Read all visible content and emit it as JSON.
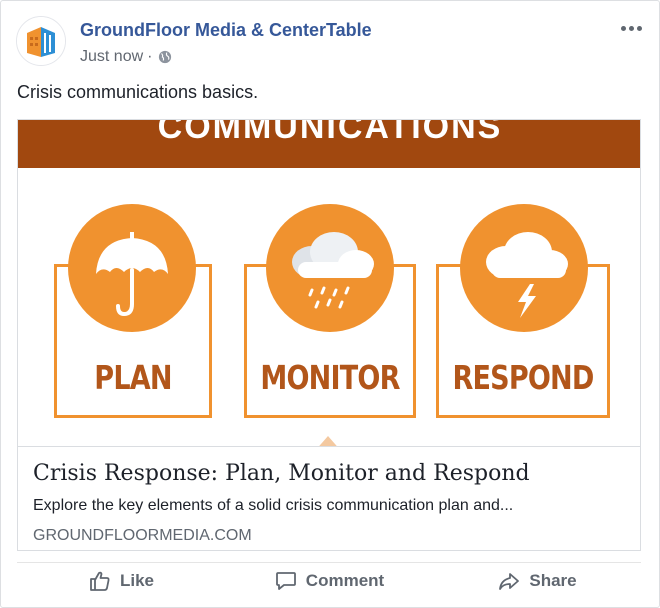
{
  "post": {
    "author": "GroundFloor Media & CenterTable",
    "timestamp": "Just now",
    "separator": "·",
    "privacy_icon": "globe-icon",
    "text": "Crisis communications basics."
  },
  "link_card": {
    "image": {
      "banner_text": "COMMUNICATIONS",
      "steps": [
        {
          "label": "PLAN",
          "icon": "umbrella-icon"
        },
        {
          "label": "MONITOR",
          "icon": "rain-cloud-icon"
        },
        {
          "label": "RESPOND",
          "icon": "storm-cloud-icon"
        }
      ]
    },
    "title": "Crisis Response: Plan, Monitor and Respond",
    "description": "Explore the key elements of a solid crisis communication plan and...",
    "domain": "GROUNDFLOORMEDIA.COM"
  },
  "actions": {
    "like": "Like",
    "comment": "Comment",
    "share": "Share"
  },
  "colors": {
    "author_link": "#365899",
    "brand_orange": "#f0922f",
    "banner_brown": "#a1480f",
    "label_brown": "#b2561a"
  }
}
